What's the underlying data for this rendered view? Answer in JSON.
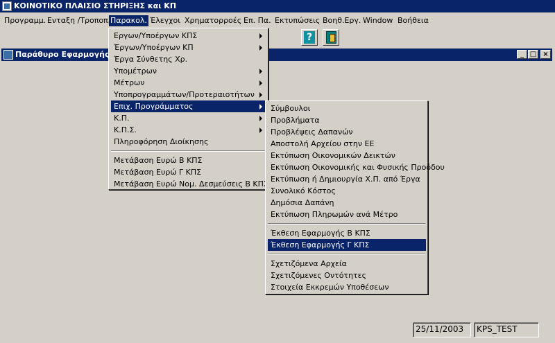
{
  "app": {
    "title": "ΚΟΙΝΟΤΙΚΟ ΠΛΑΙΣΙΟ ΣΤΗΡΙΞΗΣ και ΚΠ"
  },
  "menubar": [
    "Προγραμμ.",
    "Ενταξη /Τροποπ.",
    "Παρακολ.",
    "Έλεγχοι",
    "Χρηματορροές",
    "Επ. Πα.",
    "Εκτυπώσεις",
    "Βοηθ.Εργ.",
    "Window",
    "Βοήθεια"
  ],
  "toolbar": {
    "help_icon": "?",
    "exit_icon": "exit-door"
  },
  "child_window": {
    "title": "Παράθυρο Εφαρμογής",
    "minimize": "_",
    "maximize": "□",
    "close": "×"
  },
  "menu_parakol": {
    "items": [
      "Εργων/Υποέργων ΚΠΣ",
      "Έργων/Υποέργων ΚΠ",
      "Έργα Σύνθετης Χρ.",
      "Υπομέτρων",
      "Μέτρων",
      "Υποπρογραμμάτων/Προτεραιοτήτων",
      "Επιχ. Προγράμματος",
      "Κ.Π.",
      "Κ.Π.Σ.",
      "Πληροφόρηση Διοίκησης"
    ],
    "items2": [
      "Μετάβαση Ευρώ Β ΚΠΣ",
      "Μετάβαση Ευρώ Γ ΚΠΣ",
      "Μετάβαση Ευρώ Νομ. Δεσμεύσεις Β ΚΠΣ"
    ]
  },
  "submenu_epix": {
    "group1": [
      "Σύμβουλοι",
      "Προβλήματα",
      "Προβλέψεις Δαπανών",
      "Αποστολή Αρχείου στην ΕΕ",
      "Εκτύπωση Οικονομικών Δεικτών",
      "Εκτύπωση Οικονομικής και Φυσικής Προόδου",
      "Εκτύπωση ή Δημιουργία Χ.Π. από Έργα",
      "Συνολικό Κόστος",
      "Δημόσια Δαπάνη",
      "Εκτύπωση Πληρωμών ανά Μέτρο"
    ],
    "group2": [
      "Έκθεση Εφαρμογής Β ΚΠΣ",
      "Έκθεση Εφαρμογής Γ ΚΠΣ"
    ],
    "group3": [
      "Σχετιζόμενα Αρχεία",
      "Σχετιζόμενες Οντότητες",
      "Στοιχεία Εκκρεμών Υποθέσεων"
    ]
  },
  "status": {
    "date": "25/11/2003",
    "user": "KPS_TEST"
  }
}
